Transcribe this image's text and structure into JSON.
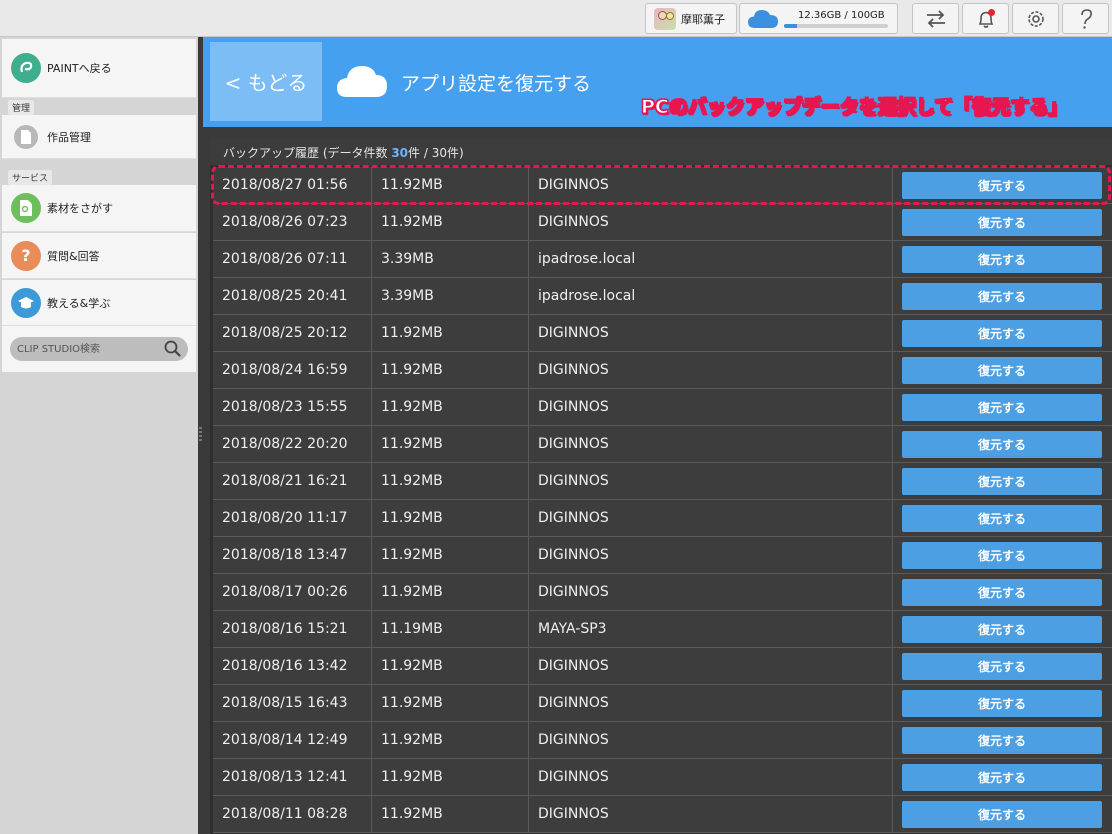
{
  "topbar": {
    "user_name": "摩耶薫子",
    "storage_text": "12.36GB / 100GB",
    "storage_fraction": 0.1236,
    "accent": "#3d8fe0",
    "notification_dot_color": "#e8232f"
  },
  "sidebar": {
    "back_to_paint": "PAINTへ戻る",
    "section_manage": "管理",
    "works_manage": "作品管理",
    "section_services": "サービス",
    "find_materials": "素材をさがす",
    "qa": "質問&回答",
    "teach_learn": "教える&学ぶ",
    "search_placeholder": "CLIP STUDIO検索"
  },
  "banner": {
    "back_label": "< もどる",
    "title": "アプリ設定を復元する",
    "annotation": "PCのバックアップデータを選択して「復元する」",
    "background": "#45a0f0"
  },
  "table": {
    "caption_prefix": "バックアップ履歴 (データ件数 ",
    "caption_count": "30",
    "caption_suffix": "件 / 30件)",
    "restore_label": "復元する",
    "rows": [
      {
        "date": "2018/08/27 01:56",
        "size": "11.92MB",
        "host": "DIGINNOS"
      },
      {
        "date": "2018/08/26 07:23",
        "size": "11.92MB",
        "host": "DIGINNOS"
      },
      {
        "date": "2018/08/26 07:11",
        "size": "3.39MB",
        "host": "ipadrose.local"
      },
      {
        "date": "2018/08/25 20:41",
        "size": "3.39MB",
        "host": "ipadrose.local"
      },
      {
        "date": "2018/08/25 20:12",
        "size": "11.92MB",
        "host": "DIGINNOS"
      },
      {
        "date": "2018/08/24 16:59",
        "size": "11.92MB",
        "host": "DIGINNOS"
      },
      {
        "date": "2018/08/23 15:55",
        "size": "11.92MB",
        "host": "DIGINNOS"
      },
      {
        "date": "2018/08/22 20:20",
        "size": "11.92MB",
        "host": "DIGINNOS"
      },
      {
        "date": "2018/08/21 16:21",
        "size": "11.92MB",
        "host": "DIGINNOS"
      },
      {
        "date": "2018/08/20 11:17",
        "size": "11.92MB",
        "host": "DIGINNOS"
      },
      {
        "date": "2018/08/18 13:47",
        "size": "11.92MB",
        "host": "DIGINNOS"
      },
      {
        "date": "2018/08/17 00:26",
        "size": "11.92MB",
        "host": "DIGINNOS"
      },
      {
        "date": "2018/08/16 15:21",
        "size": "11.19MB",
        "host": "MAYA-SP3"
      },
      {
        "date": "2018/08/16 13:42",
        "size": "11.92MB",
        "host": "DIGINNOS"
      },
      {
        "date": "2018/08/15 16:43",
        "size": "11.92MB",
        "host": "DIGINNOS"
      },
      {
        "date": "2018/08/14 12:49",
        "size": "11.92MB",
        "host": "DIGINNOS"
      },
      {
        "date": "2018/08/13 12:41",
        "size": "11.92MB",
        "host": "DIGINNOS"
      },
      {
        "date": "2018/08/11 08:28",
        "size": "11.92MB",
        "host": "DIGINNOS"
      }
    ]
  }
}
